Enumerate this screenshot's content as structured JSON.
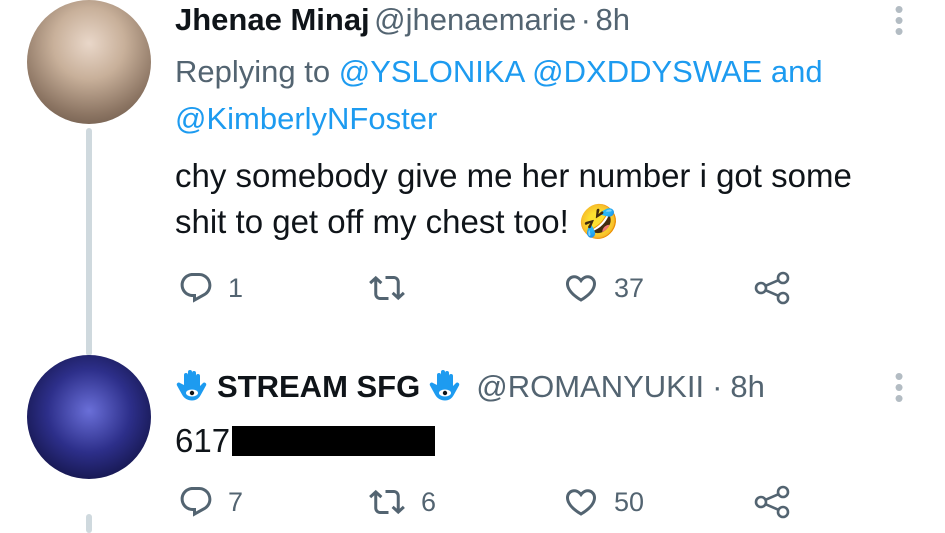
{
  "tweets": [
    {
      "display_name": "Jhenae Minaj",
      "handle": "@jhenaemarie",
      "separator": "·",
      "time": "8h",
      "replying_prefix": "Replying to",
      "mentions": [
        "@YSLONIKA",
        "@DXDDYSWAE"
      ],
      "mentions_joiner": "and",
      "mention_last": "@KimberlyNFoster",
      "text_line1": "chy somebody give me her number i got some",
      "text_line2": "shit to get off my chest too!",
      "emoji": "🤣",
      "reply_count": "1",
      "retweet_count": "",
      "like_count": "37"
    },
    {
      "display_name": "STREAM SFG",
      "handle": "@ROMANYUKII",
      "separator": "·",
      "time": "8h",
      "text_prefix": "617",
      "reply_count": "7",
      "retweet_count": "6",
      "like_count": "50"
    }
  ],
  "colors": {
    "link": "#1d9bf0",
    "muted": "#536471",
    "thread_line": "#cfd9de",
    "hamsa_blue": "#1d9bf0"
  },
  "icons": {
    "reply": "reply-icon",
    "retweet": "retweet-icon",
    "like": "heart-icon",
    "share": "share-icon",
    "more": "more-icon",
    "hamsa": "hamsa-emoji"
  }
}
